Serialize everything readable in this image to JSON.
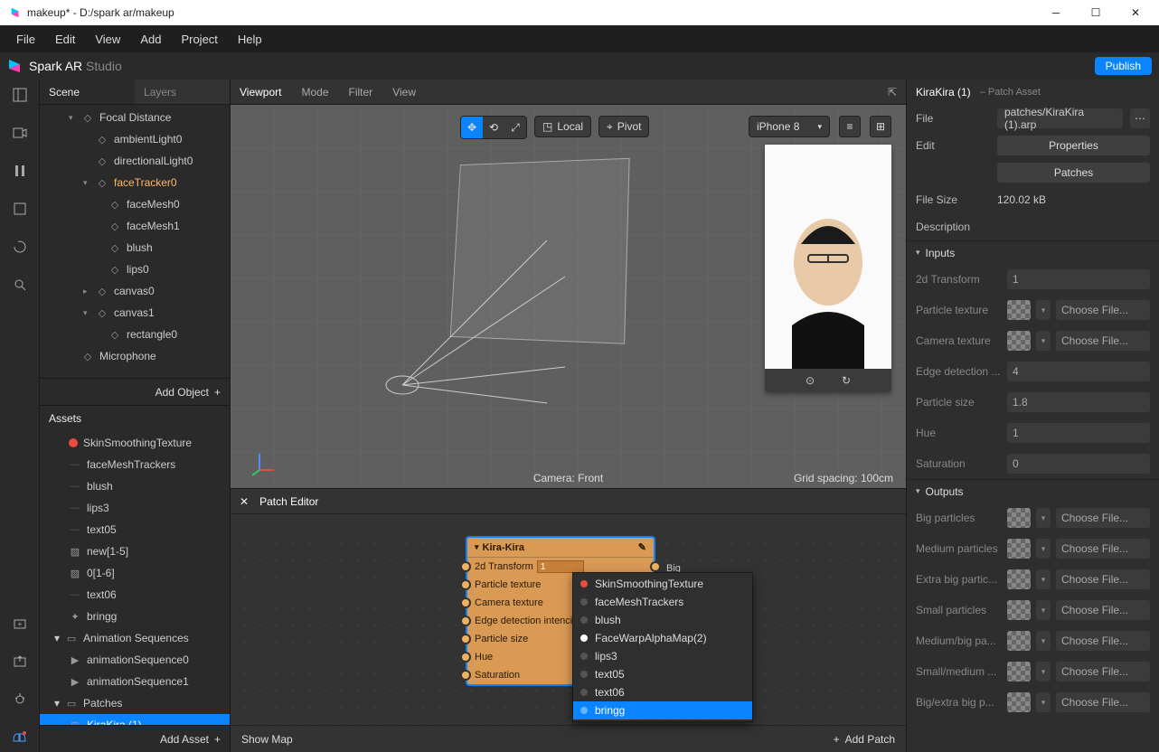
{
  "titlebar": {
    "title": "makeup* - D:/spark ar/makeup"
  },
  "menubar": [
    "File",
    "Edit",
    "View",
    "Add",
    "Project",
    "Help"
  ],
  "brand": {
    "name_a": "Spark AR ",
    "name_b": "Studio",
    "publish": "Publish"
  },
  "scene": {
    "tab_scene": "Scene",
    "tab_layers": "Layers",
    "items": [
      {
        "label": "Focal Distance",
        "icon": "focal",
        "indent": 2,
        "chev": "▾"
      },
      {
        "label": "ambientLight0",
        "icon": "light",
        "indent": 3
      },
      {
        "label": "directionalLight0",
        "icon": "dir",
        "indent": 3
      },
      {
        "label": "faceTracker0",
        "icon": "tracker",
        "indent": 3,
        "chev": "▾",
        "sel": true
      },
      {
        "label": "faceMesh0",
        "icon": "mesh",
        "indent": 4
      },
      {
        "label": "faceMesh1",
        "icon": "mesh",
        "indent": 4
      },
      {
        "label": "blush",
        "icon": "mesh",
        "indent": 4
      },
      {
        "label": "lips0",
        "icon": "mesh",
        "indent": 4
      },
      {
        "label": "canvas0",
        "icon": "canvas",
        "indent": 3,
        "chev": "▸"
      },
      {
        "label": "canvas1",
        "icon": "canvas",
        "indent": 3,
        "chev": "▾"
      },
      {
        "label": "rectangle0",
        "icon": "rect",
        "indent": 4
      },
      {
        "label": "Microphone",
        "icon": "mic",
        "indent": 2
      }
    ],
    "add_object": "Add Object"
  },
  "assets": {
    "title": "Assets",
    "items": [
      {
        "label": "SkinSmoothingTexture",
        "dot": "#e74c3c"
      },
      {
        "label": "faceMeshTrackers"
      },
      {
        "label": "blush"
      },
      {
        "label": "lips3"
      },
      {
        "label": "text05"
      },
      {
        "label": "new[1-5]",
        "icon": "img"
      },
      {
        "label": "0[1-6]",
        "icon": "img"
      },
      {
        "label": "text06"
      },
      {
        "label": "bringg",
        "icon": "star"
      }
    ],
    "group_label": "Animation Sequences",
    "seq": [
      "animationSequence0",
      "animationSequence1"
    ],
    "patches_label": "Patches",
    "patches": [
      "KiraKira (1)"
    ],
    "add_asset": "Add Asset"
  },
  "viewport": {
    "title": "Viewport",
    "items": [
      "Mode",
      "Filter",
      "View"
    ],
    "local": "Local",
    "pivot": "Pivot",
    "device": "iPhone 8",
    "camlabel": "Camera: Front",
    "gridlabel": "Grid spacing: 100cm"
  },
  "patch": {
    "title": "Patch Editor",
    "node": {
      "title": "Kira-Kira",
      "rows": [
        "2d Transform",
        "Particle texture",
        "Camera texture",
        "Edge detection intencity",
        "Particle size",
        "Hue",
        "Saturation"
      ],
      "val0": "1",
      "outs": [
        "Big particles",
        "Medium particles"
      ]
    },
    "popup": [
      {
        "label": "SkinSmoothingTexture",
        "dot": "#e74c3c"
      },
      {
        "label": "faceMeshTrackers"
      },
      {
        "label": "blush"
      },
      {
        "label": "FaceWarpAlphaMap(2)",
        "dot": "#fff"
      },
      {
        "label": "lips3"
      },
      {
        "label": "text05"
      },
      {
        "label": "text06"
      },
      {
        "label": "bringg",
        "sel": true,
        "dot": "#64b5ff"
      }
    ],
    "showmap": "Show Map",
    "addpatch": "Add Patch"
  },
  "inspector": {
    "title": "KiraKira (1)",
    "subtitle": "– Patch Asset",
    "file_lbl": "File",
    "file_val": "patches/KiraKira (1).arp",
    "edit_lbl": "Edit",
    "properties": "Properties",
    "patches_btn": "Patches",
    "size_lbl": "File Size",
    "size_val": "120.02 kB",
    "desc_lbl": "Description",
    "inputs_lbl": "Inputs",
    "inputs": [
      {
        "label": "2d Transform",
        "val": "1"
      },
      {
        "label": "Particle texture",
        "type": "tex",
        "choose": "Choose File..."
      },
      {
        "label": "Camera texture",
        "type": "tex",
        "choose": "Choose File..."
      },
      {
        "label": "Edge detection ...",
        "val": "4"
      },
      {
        "label": "Particle size",
        "val": "1.8"
      },
      {
        "label": "Hue",
        "val": "1"
      },
      {
        "label": "Saturation",
        "val": "0"
      }
    ],
    "outputs_lbl": "Outputs",
    "outputs": [
      {
        "label": "Big particles"
      },
      {
        "label": "Medium particles"
      },
      {
        "label": "Extra big partic..."
      },
      {
        "label": "Small particles"
      },
      {
        "label": "Medium/big pa..."
      },
      {
        "label": "Small/medium ..."
      },
      {
        "label": "Big/extra big p..."
      }
    ],
    "choose": "Choose File..."
  }
}
